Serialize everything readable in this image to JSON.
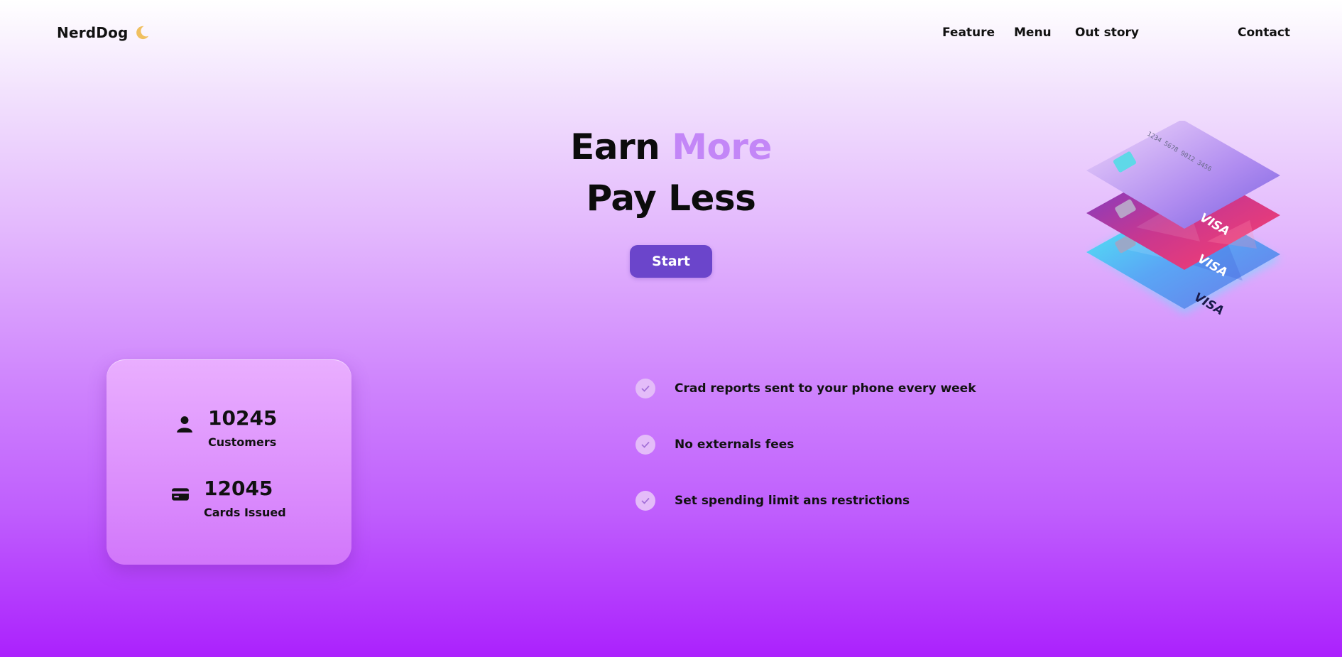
{
  "header": {
    "logo_text": "NerdDog",
    "logo_icon": "moon-icon",
    "nav": [
      {
        "label": "Feature"
      },
      {
        "label": "Menu"
      },
      {
        "label": "Out story"
      },
      {
        "label": "Contact"
      }
    ]
  },
  "hero": {
    "title_word1": "Earn",
    "title_word2": "More",
    "title_line2": "Pay Less",
    "start_label": "Start"
  },
  "cards_illustration": {
    "card_number": "1234 5678 9012 3456",
    "brand": "VISA"
  },
  "stats": [
    {
      "icon": "user-icon",
      "value": "10245",
      "label": "Customers"
    },
    {
      "icon": "credit-card-icon",
      "value": "12045",
      "label": "Cards Issued"
    }
  ],
  "features": [
    {
      "icon": "check-icon",
      "text": "Crad reports sent to your phone every week"
    },
    {
      "icon": "check-icon",
      "text": "No externals fees"
    },
    {
      "icon": "check-icon",
      "text": "Set spending limit ans restrictions"
    }
  ],
  "colors": {
    "accent": "#c386f7",
    "button": "#6b45cb",
    "moon": "#f0c060"
  }
}
